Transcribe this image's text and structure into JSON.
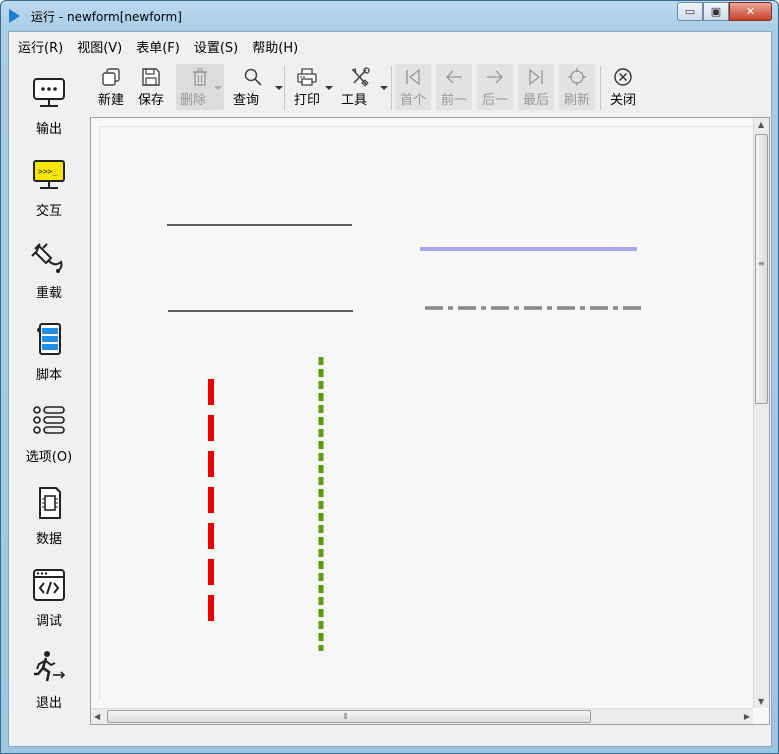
{
  "window": {
    "title": "运行 - newform[newform]",
    "controls": {
      "minimize": "▭",
      "maximize": "▣",
      "close": "✕"
    }
  },
  "menu": [
    {
      "label": "运行(R)"
    },
    {
      "label": "视图(V)"
    },
    {
      "label": "表单(F)"
    },
    {
      "label": "设置(S)"
    },
    {
      "label": "帮助(H)"
    }
  ],
  "sidebar": [
    {
      "label": "输出",
      "icon": "monitor-icon"
    },
    {
      "label": "交互",
      "icon": "terminal-icon"
    },
    {
      "label": "重载",
      "icon": "plug-icon"
    },
    {
      "label": "脚本",
      "icon": "script-icon"
    },
    {
      "label": "选项(O)",
      "icon": "options-list-icon"
    },
    {
      "label": "数据",
      "icon": "chip-icon"
    },
    {
      "label": "调试",
      "icon": "code-window-icon"
    },
    {
      "label": "退出",
      "icon": "exit-icon"
    }
  ],
  "toolbar": {
    "new": "新建",
    "save": "保存",
    "delete": "删除",
    "query": "查询",
    "print": "打印",
    "tools": "工具",
    "first": "首个",
    "prev": "前一",
    "next": "后一",
    "last": "最后",
    "refresh": "刷新",
    "close": "关闭"
  },
  "colors": {
    "red_dashed": "#ee0000",
    "green_dashed": "#55a000",
    "blue_line": "#a8a8f0",
    "gray_dashdot": "#888888",
    "black_line": "#000000"
  }
}
